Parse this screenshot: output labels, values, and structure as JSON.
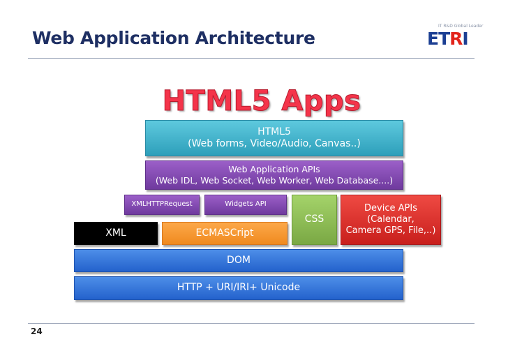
{
  "slide": {
    "title": "Web Application Architecture",
    "number": "24"
  },
  "logo": {
    "tagline": "IT R&D Global Leader",
    "word_prefix": "ET",
    "word_r": "R",
    "word_suffix": "I"
  },
  "diagram": {
    "heading": "HTML5 Apps",
    "html5": {
      "line1": "HTML5",
      "line2": "(Web forms, Video/Audio, Canvas..)"
    },
    "web_app_apis": {
      "line1": "Web Application APIs",
      "line2": "(Web IDL, Web Socket, Web Worker, Web Database....)"
    },
    "xmlhttprequest": "XMLHTTPRequest",
    "widgets_api": "Widgets API",
    "css": "CSS",
    "device_apis": {
      "line1": "Device APIs",
      "line2": "(Calendar,",
      "line3": "Camera GPS, File,..)"
    },
    "xml": "XML",
    "ecmascript": "ECMASCript",
    "dom": "DOM",
    "http": "HTTP  +  URI/IRI+  Unicode"
  }
}
